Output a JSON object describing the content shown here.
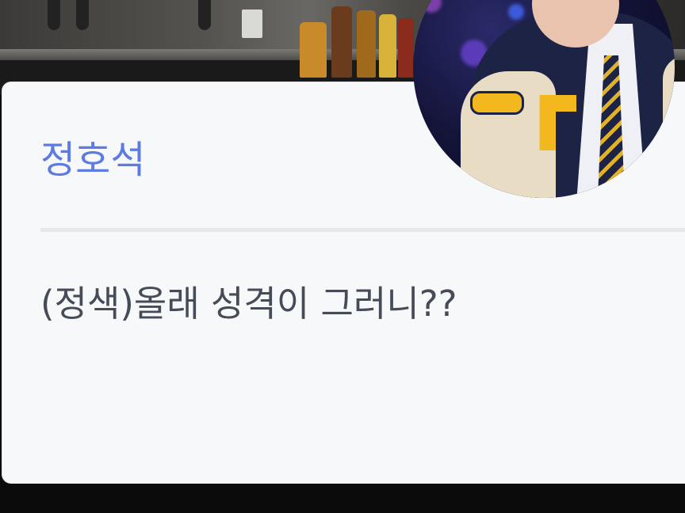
{
  "dialogue": {
    "speaker_name": "정호석",
    "text": "(정색)올래 성격이 그러니??"
  },
  "portrait": {
    "icon": "character-portrait"
  },
  "background": {
    "icon": "kitchen-background"
  },
  "colors": {
    "speaker": "#5f7be0",
    "text": "#454c57",
    "panel": "#f7f8fa",
    "bottom_bar": "#0b0b0c"
  }
}
